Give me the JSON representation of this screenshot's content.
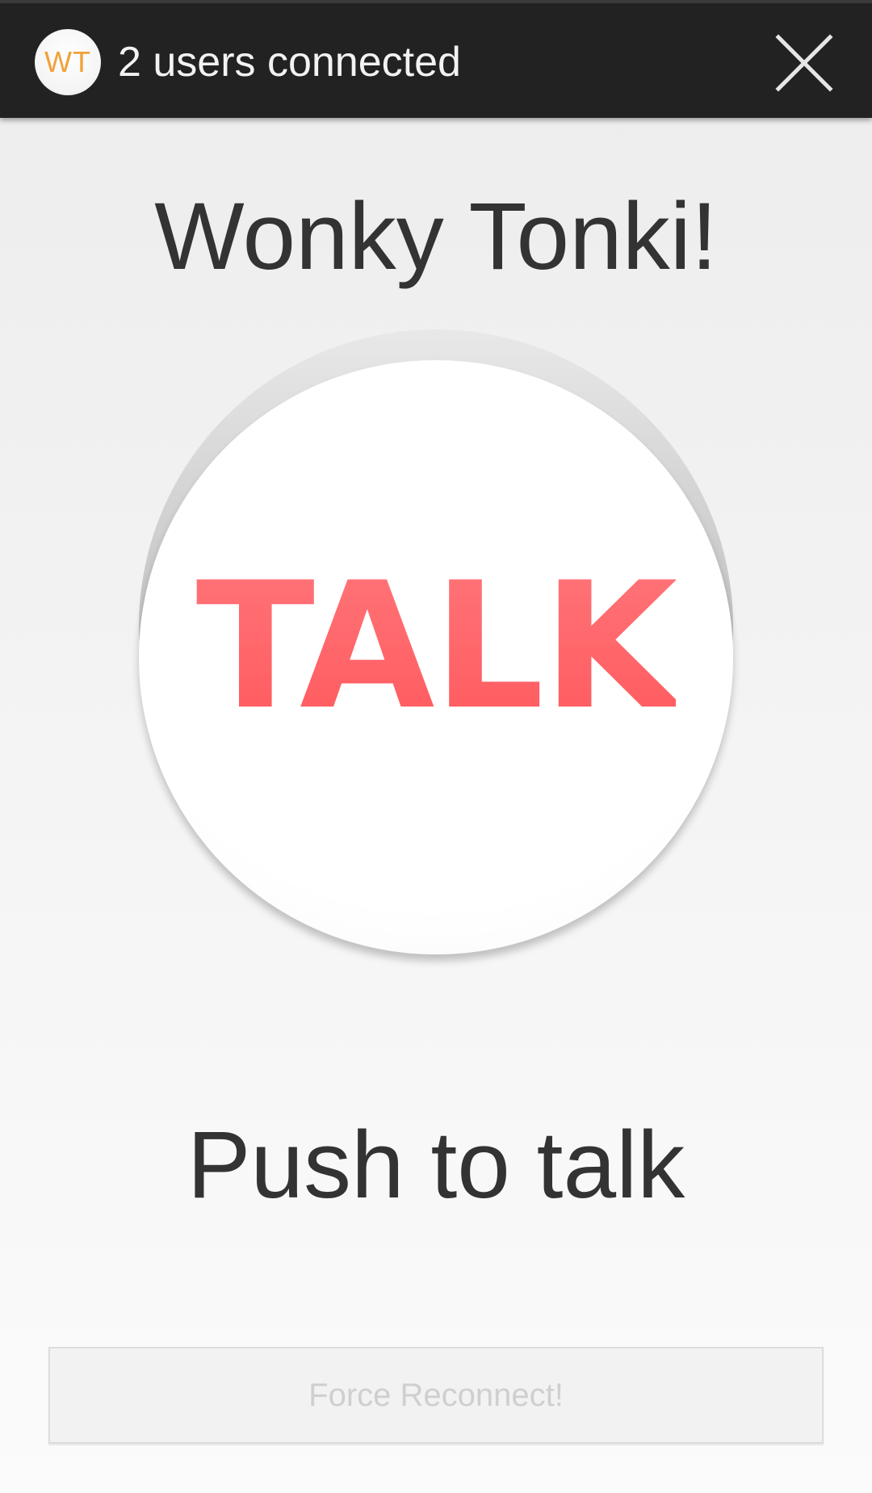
{
  "topbar": {
    "logo_text": "WT",
    "status": "2 users connected",
    "close_icon": "close-icon",
    "background": "#222222",
    "logo_color": "#f0a23a"
  },
  "main": {
    "title": "Wonky Tonki!",
    "talk_label": "TALK",
    "talk_color": "#ff6266",
    "instruction": "Push to talk"
  },
  "footer": {
    "reconnect_label": "Force Reconnect!",
    "reconnect_enabled": false
  }
}
